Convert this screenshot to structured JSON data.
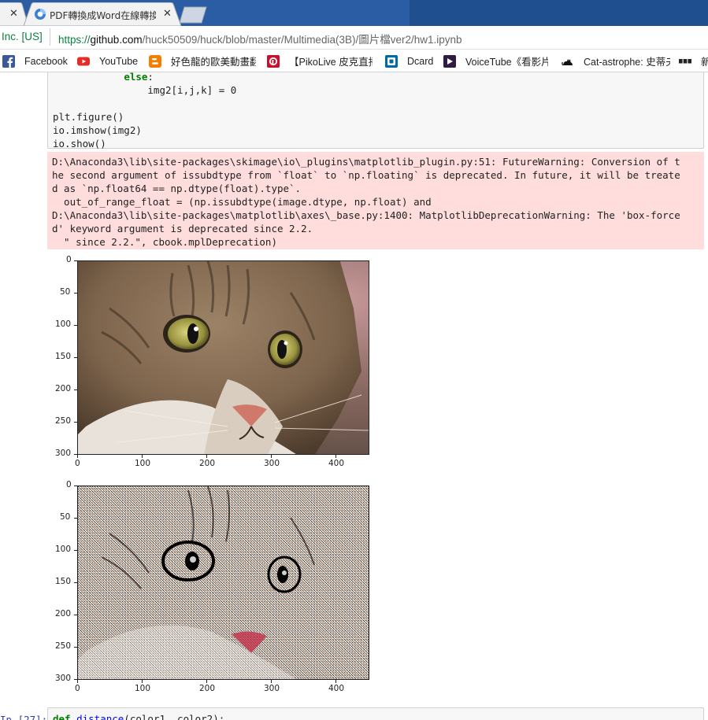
{
  "browser": {
    "tabs": [
      {
        "label": "",
        "close": "✕"
      },
      {
        "label": "PDF轉換成Word在線轉換",
        "close": "✕"
      },
      {
        "label": ""
      }
    ],
    "address": {
      "secure_label": "Inc. [US]",
      "url_protocol": "https://",
      "url_host": "github.com",
      "url_path": "/huck50509/huck/blob/master/Multimedia(3B)/圖片檔ver2/hw1.ipynb"
    },
    "bookmarks": [
      {
        "label": "Facebook",
        "icon": "facebook-icon"
      },
      {
        "label": "YouTube",
        "icon": "youtube-icon"
      },
      {
        "label": "好色龍的歐美動畫翻譯",
        "icon": "blogger-icon"
      },
      {
        "label": "【PikoLive 皮克直播】",
        "icon": "pikolive-icon"
      },
      {
        "label": "Dcard",
        "icon": "dcard-icon"
      },
      {
        "label": "VoiceTube《看影片學英語》",
        "icon": "voicetube-icon"
      },
      {
        "label": "Cat-astrophe: 史蒂夫",
        "icon": "cat-icon"
      },
      {
        "label": "新",
        "icon": "bbc-icon"
      }
    ],
    "colors": {
      "tabstrip": "#2a5da3",
      "secure_green": "#0b8043"
    }
  },
  "notebook": {
    "code_lines": [
      {
        "pre": "            ",
        "kw": "else",
        "rest": ":"
      },
      {
        "pre": "                img2[i,j,k] = 0",
        "kw": "",
        "rest": ""
      },
      {
        "pre": "",
        "kw": "",
        "rest": ""
      },
      {
        "pre": "plt.figure()",
        "kw": "",
        "rest": ""
      },
      {
        "pre": "io.imshow(img2)",
        "kw": "",
        "rest": ""
      },
      {
        "pre": "io.show()",
        "kw": "",
        "rest": ""
      }
    ],
    "stderr_lines": [
      "D:\\Anaconda3\\lib\\site-packages\\skimage\\io\\_plugins\\matplotlib_plugin.py:51: FutureWarning: Conversion of t",
      "he second argument of issubdtype from `float` to `np.floating` is deprecated. In future, it will be treate",
      "d as `np.float64 == np.dtype(float).type`.",
      "  out_of_range_float = (np.issubdtype(image.dtype, np.float) and",
      "D:\\Anaconda3\\lib\\site-packages\\matplotlib\\axes\\_base.py:1400: MatplotlibDeprecationWarning: The 'box-force",
      "d' keyword argument is deprecated since 2.2.",
      "  \" since 2.2.\", cbook.mplDeprecation)"
    ],
    "plot_y_ticks": [
      "0",
      "50",
      "100",
      "150",
      "200",
      "250",
      "300"
    ],
    "plot_x_ticks": [
      "0",
      "100",
      "200",
      "300",
      "400"
    ],
    "next_prompt": "In [27]:",
    "next_code": {
      "kw": "def",
      "fn": "distance",
      "rest": "(color1, color2):"
    }
  }
}
